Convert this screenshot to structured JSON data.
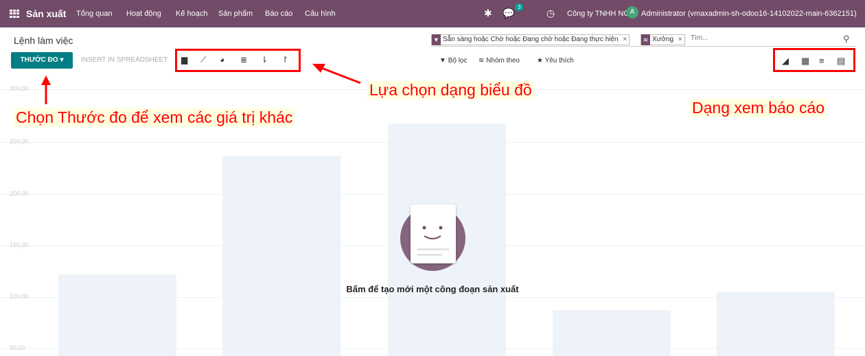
{
  "topbar": {
    "app_name": "Sản xuất",
    "menu": [
      "Tổng quan",
      "Hoạt động",
      "Kế hoạch",
      "Sản phẩm",
      "Báo cáo",
      "Cấu hình"
    ],
    "message_count": "3",
    "company": "Công ty TNHH NOS",
    "avatar_letter": "A",
    "user": "Administrator (vmaxadmin-sh-odoo16-14102022-main-6362151)"
  },
  "breadcrumb": "Lệnh làm việc",
  "search": {
    "facet1": "Sẵn sàng hoặc Chờ hoặc Đang chờ hoặc Đang thực hiện",
    "facet2": "Xưởng",
    "placeholder": "Tìm..."
  },
  "toolbar": {
    "measure_label": "THƯỚC ĐO",
    "insert_label": "INSERT IN SPREADSHEET",
    "filter_label": "Bộ lọc",
    "group_label": "Nhóm theo",
    "favorite_label": "Yêu thích"
  },
  "chart_ticks": [
    "300,00",
    "250,00",
    "200,00",
    "150,00",
    "100,00",
    "50,00"
  ],
  "annotations": {
    "chart_type": "Lựa chọn dạng biểu đồ",
    "measure": "Chọn Thước đo để xem các giá trị khác",
    "views": "Dạng xem báo cáo"
  },
  "empty_state": "Bấm để tạo mới một công đoạn sản xuất",
  "colors": {
    "brand": "#714b67",
    "primary": "#017e84",
    "annotation": "#ff0000"
  },
  "icons": [
    "apps-icon",
    "bug-icon",
    "chat-icon",
    "clock-icon",
    "search-icon",
    "filter-icon",
    "layers-icon",
    "star-icon",
    "bar-chart-icon",
    "line-chart-icon",
    "pie-chart-icon",
    "stack-icon",
    "sort-desc-icon",
    "sort-asc-icon",
    "graph-view-icon",
    "pivot-view-icon",
    "list-view-icon",
    "report-view-icon"
  ]
}
